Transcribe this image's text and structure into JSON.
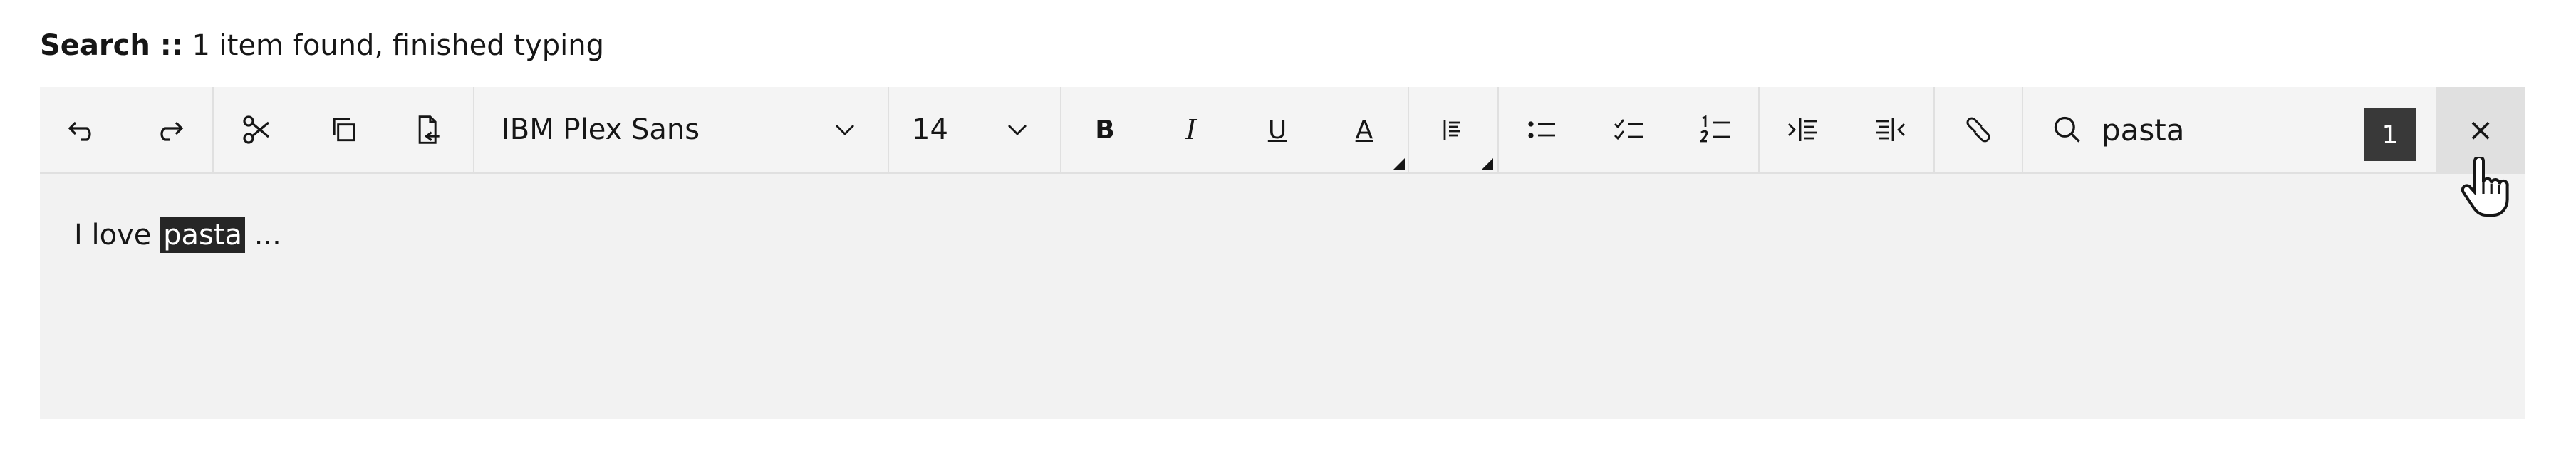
{
  "caption": {
    "label": "Search ::",
    "status": "1 item found, finished typing"
  },
  "toolbar": {
    "buttons": [
      {
        "name": "undo-icon"
      },
      {
        "name": "redo-icon"
      },
      {
        "name": "cut-icon"
      },
      {
        "name": "copy-icon"
      },
      {
        "name": "paste-icon"
      }
    ],
    "font_family": {
      "value": "IBM Plex Sans"
    },
    "font_size": {
      "value": "14"
    },
    "bold_label": "B",
    "italic_label": "I",
    "underline_label": "U",
    "font_color_label": "A",
    "search": {
      "query": "pasta",
      "match_count": "1"
    },
    "close_label": "×"
  },
  "document": {
    "before": "I love ",
    "highlight": "pasta",
    "after": " ..."
  }
}
